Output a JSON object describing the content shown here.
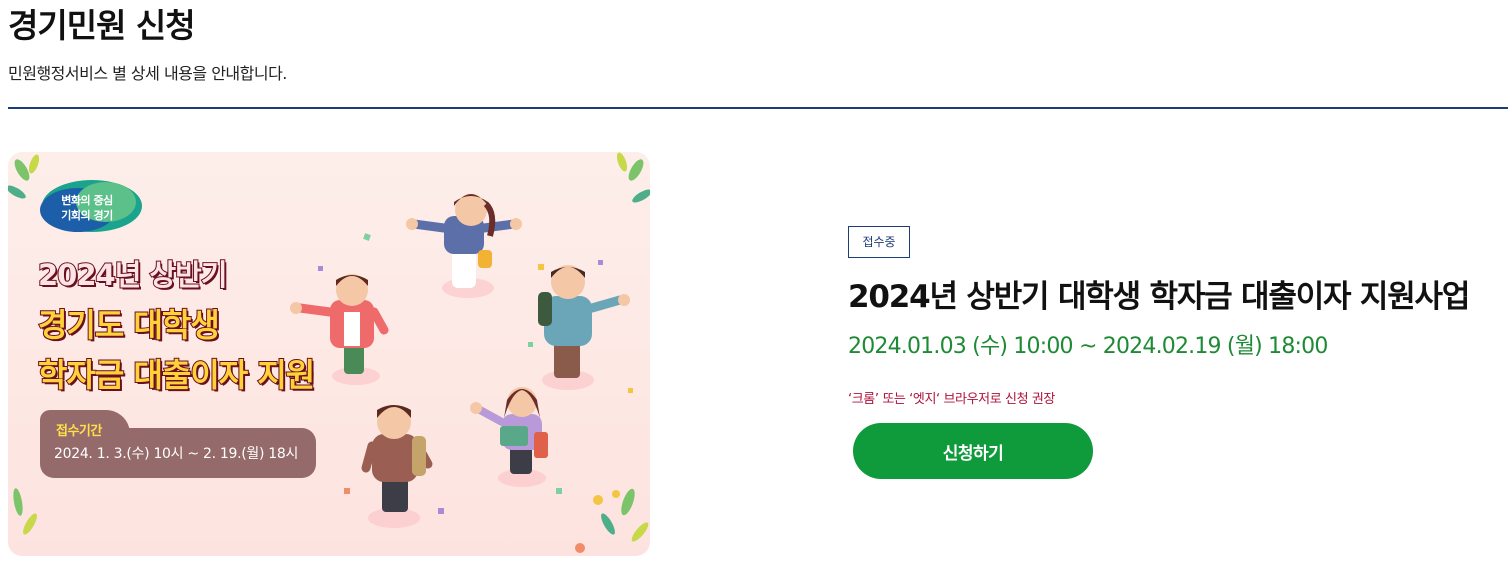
{
  "header": {
    "title": "경기민원 신청",
    "description": "민원행정서비스 별 상세 내용을 안내합니다."
  },
  "banner": {
    "brand_line1": "변화의 중심",
    "brand_line2": "기회의 경기",
    "headline_line1": "2024년 상반기",
    "headline_line2": "경기도 대학생",
    "headline_line3": "학자금 대출이자 지원",
    "period_label": "접수기간",
    "period_value": "2024. 1. 3.(수) 10시 ~ 2. 19.(월) 18시"
  },
  "service": {
    "status": "접수중",
    "title": "2024년 상반기 대학생 학자금 대출이자 지원사업",
    "period": "2024.01.03 (수) 10:00 ~ 2024.02.19 (월) 18:00",
    "browser_notice": "‘크롬’ 또는 ‘엣지‘ 브라우저로 신청 권장",
    "apply_label": "신청하기"
  },
  "colors": {
    "accent": "#1d3c78",
    "period_green": "#1f8a35",
    "notice_red": "#b0113a",
    "button_green": "#0f9a3c"
  }
}
